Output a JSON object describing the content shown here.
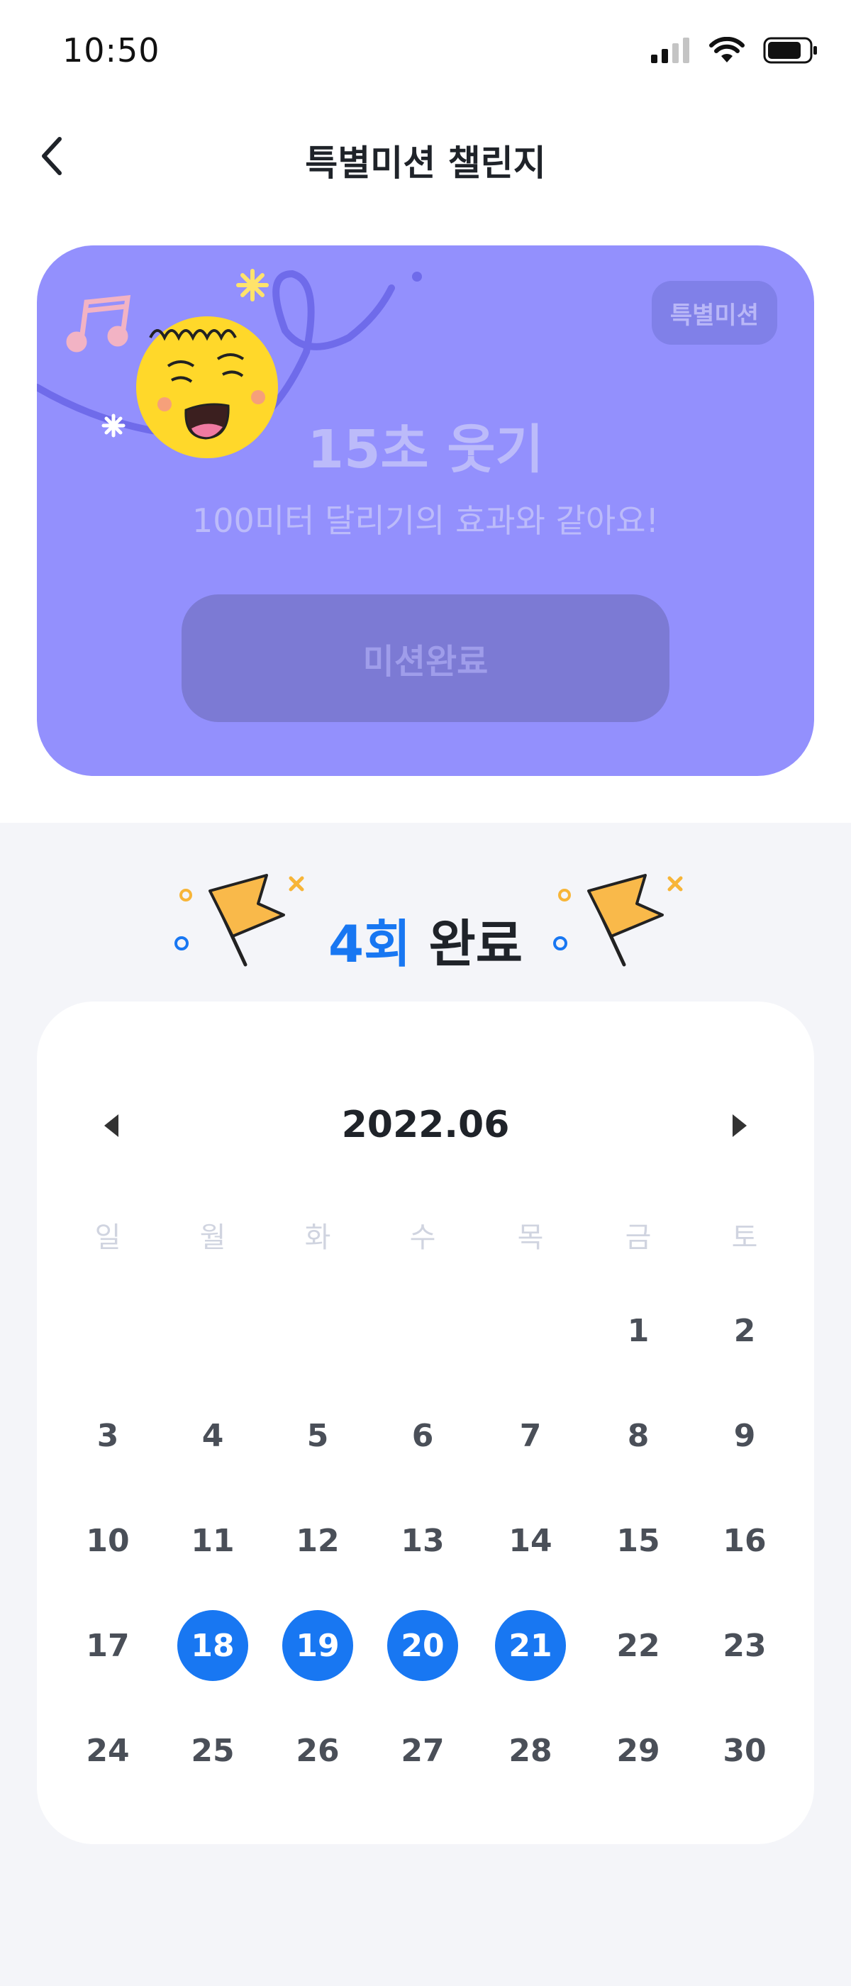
{
  "status_bar": {
    "time": "10:50"
  },
  "header": {
    "title": "특별미션 챌린지"
  },
  "mission": {
    "badge": "특별미션",
    "title": "15초 웃기",
    "description": "100미터 달리기의 효과와 같아요!",
    "complete_button": "미션완료"
  },
  "progress": {
    "count": "4회",
    "label": "완료"
  },
  "calendar": {
    "month": "2022.06",
    "weekdays": [
      "일",
      "월",
      "화",
      "수",
      "목",
      "금",
      "토"
    ],
    "first_weekday_index": 5,
    "days_in_month": 30,
    "completed_days": [
      18,
      19,
      20,
      21
    ]
  },
  "colors": {
    "accent": "#1877f2",
    "card": "#9390fd",
    "section_bg": "#f4f5f9"
  },
  "icons": {
    "back": "chevron-left-icon",
    "prev": "triangle-left-icon",
    "next": "triangle-right-icon",
    "flag": "flag-icon"
  }
}
